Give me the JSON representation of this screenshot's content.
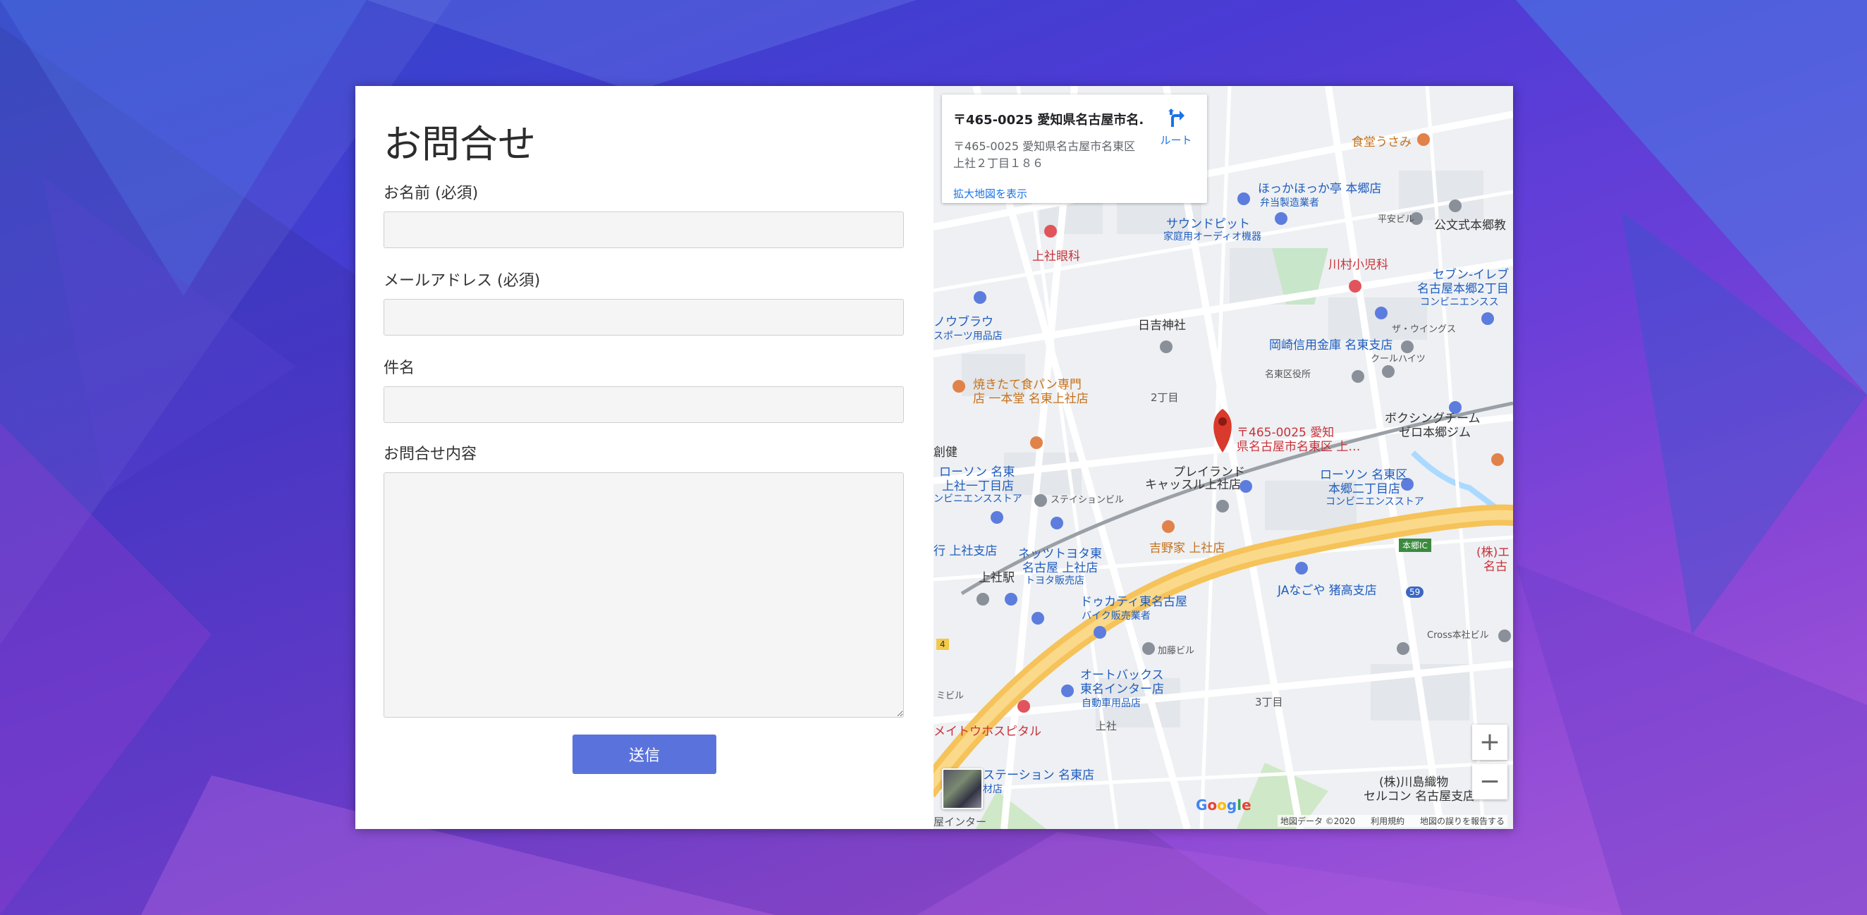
{
  "form": {
    "title": "お問合せ",
    "name_label": "お名前 (必須)",
    "email_label": "メールアドレス (必須)",
    "subject_label": "件名",
    "message_label": "お問合せ内容",
    "name_value": "",
    "email_value": "",
    "subject_value": "",
    "message_value": "",
    "submit_label": "送信"
  },
  "map": {
    "info_title": "〒465-0025 愛知県名古屋市名...",
    "info_address": "〒465-0025 愛知県名古屋市名東区上社２丁目１８６",
    "info_link": "拡大地図を表示",
    "route_label": "ルート",
    "marker_label_1": "〒465-0025 愛知",
    "marker_label_2": "県名古屋市名東区 上…",
    "zoom_in": "+",
    "zoom_out": "−",
    "attribution": [
      "地図データ ©2020",
      "利用規約",
      "地図の誤りを報告する"
    ],
    "pois": [
      {
        "text": "食堂うさみ",
        "color": "orange"
      },
      {
        "text": "ほっかほっか亭 本郷店",
        "color": "blue"
      },
      {
        "text": "弁当製造業者",
        "color": "blue"
      },
      {
        "text": "平安ビル",
        "color": "gray"
      },
      {
        "text": "公文式本郷教",
        "color": "dark"
      },
      {
        "text": "サウンドピット",
        "color": "blue"
      },
      {
        "text": "家庭用オーディオ機器",
        "color": "blue"
      },
      {
        "text": "上社眼科",
        "color": "red"
      },
      {
        "text": "川村小児科",
        "color": "red"
      },
      {
        "text": "セブン-イレブ",
        "color": "blue"
      },
      {
        "text": "名古屋本郷2丁目",
        "color": "blue"
      },
      {
        "text": "コンビニエンスス",
        "color": "blue"
      },
      {
        "text": "ノウブラウ",
        "color": "blue"
      },
      {
        "text": "スポーツ用品店",
        "color": "blue"
      },
      {
        "text": "日吉神社",
        "color": "dark"
      },
      {
        "text": "ザ・ウイングス",
        "color": "gray"
      },
      {
        "text": "岡崎信用金庫 名東支店",
        "color": "blue"
      },
      {
        "text": "クールハイツ",
        "color": "gray"
      },
      {
        "text": "名東区役所",
        "color": "gray"
      },
      {
        "text": "焼きたて食パン専門",
        "color": "orange"
      },
      {
        "text": "店 一本堂 名東上社店",
        "color": "orange"
      },
      {
        "text": "2丁目",
        "color": "gray"
      },
      {
        "text": "ボクシングチーム",
        "color": "dark"
      },
      {
        "text": "ゼロ本郷ジム",
        "color": "dark"
      },
      {
        "text": "創健",
        "color": "dark"
      },
      {
        "text": "ローソン 名東",
        "color": "blue"
      },
      {
        "text": "上社一丁目店",
        "color": "blue"
      },
      {
        "text": "ンビニエンスストア",
        "color": "blue"
      },
      {
        "text": "プレイランド",
        "color": "dark"
      },
      {
        "text": "キャッスル上社店",
        "color": "dark"
      },
      {
        "text": "ステイションビル",
        "color": "gray"
      },
      {
        "text": "ローソン 名東区",
        "color": "blue"
      },
      {
        "text": "本郷二丁目店",
        "color": "blue"
      },
      {
        "text": "コンビニエンスストア",
        "color": "blue"
      },
      {
        "text": "吉野家 上社店",
        "color": "orange"
      },
      {
        "text": "本郷IC",
        "color": "badge"
      },
      {
        "text": "(株)エ",
        "color": "red"
      },
      {
        "text": "名古",
        "color": "red"
      },
      {
        "text": "行 上社支店",
        "color": "blue"
      },
      {
        "text": "ネッツトヨタ東",
        "color": "blue"
      },
      {
        "text": "名古屋 上社店",
        "color": "blue"
      },
      {
        "text": "トヨタ販売店",
        "color": "blue"
      },
      {
        "text": "上社駅",
        "color": "dark"
      },
      {
        "text": "JAなごや 猪高支店",
        "color": "blue"
      },
      {
        "text": "ドゥカティ東名古屋",
        "color": "blue"
      },
      {
        "text": "バイク販売業者",
        "color": "blue"
      },
      {
        "text": "Cross本社ビル",
        "color": "gray"
      },
      {
        "text": "加藤ビル",
        "color": "gray"
      },
      {
        "text": "オートバックス",
        "color": "blue"
      },
      {
        "text": "東名インター店",
        "color": "blue"
      },
      {
        "text": "自動車用品店",
        "color": "blue"
      },
      {
        "text": "3丁目",
        "color": "gray"
      },
      {
        "text": "ミビル",
        "color": "gray"
      },
      {
        "text": "メイトウホスピタル",
        "color": "red"
      },
      {
        "text": "上社",
        "color": "gray"
      },
      {
        "text": "(株)川島織物",
        "color": "dark"
      },
      {
        "text": "セルコン 名古屋支店",
        "color": "dark"
      },
      {
        "text": "ステーション 名東店",
        "color": "blue"
      },
      {
        "text": "材店",
        "color": "blue"
      },
      {
        "text": "屋インター",
        "color": "gray"
      },
      {
        "text": "4",
        "color": "badge-yellow"
      },
      {
        "text": "59",
        "color": "badge-blue"
      }
    ]
  },
  "colors": {
    "submit": "#5a73dc",
    "marker": "#d93a2b",
    "highway": "#f7c85a",
    "link": "#1a73e8"
  }
}
